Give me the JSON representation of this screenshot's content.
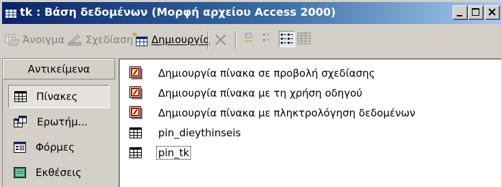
{
  "window": {
    "title": "tk : Βάση δεδομένων (Μορφή αρχείου Access 2000)"
  },
  "toolbar": {
    "open_label": "Άνοιγμα",
    "design_label": "Σχεδίαση",
    "new_label": "Δημιουργία",
    "icons": [
      "open-icon",
      "design-icon",
      "new-icon",
      "delete-icon",
      "large-icons-view",
      "small-icons-view",
      "list-view",
      "details-view"
    ]
  },
  "objects": {
    "header": "Αντικείμενα",
    "items": [
      {
        "label": "Πίνακες",
        "icon": "table-icon",
        "selected": true
      },
      {
        "label": "Ερωτήμ...",
        "icon": "query-icon",
        "selected": false
      },
      {
        "label": "Φόρμες",
        "icon": "form-icon",
        "selected": false
      },
      {
        "label": "Εκθέσεις",
        "icon": "report-icon",
        "selected": false
      }
    ]
  },
  "list": {
    "items": [
      {
        "label": "Δημιουργία πίνακα σε προβολή σχεδίασης",
        "icon": "wizard-icon"
      },
      {
        "label": "Δημιουργία πίνακα με τη χρήση οδηγού",
        "icon": "wizard-icon"
      },
      {
        "label": "Δημιουργία πίνακα με πληκτρολόγηση δεδομένων",
        "icon": "wizard-icon"
      },
      {
        "label": "pin_dieythinseis",
        "icon": "table-icon"
      },
      {
        "label": "pin_tk",
        "icon": "table-icon",
        "focused": true
      }
    ]
  },
  "colors": {
    "titlebar_start": "#0a246a",
    "titlebar_end": "#a6caf0",
    "face": "#d4d0c8"
  }
}
